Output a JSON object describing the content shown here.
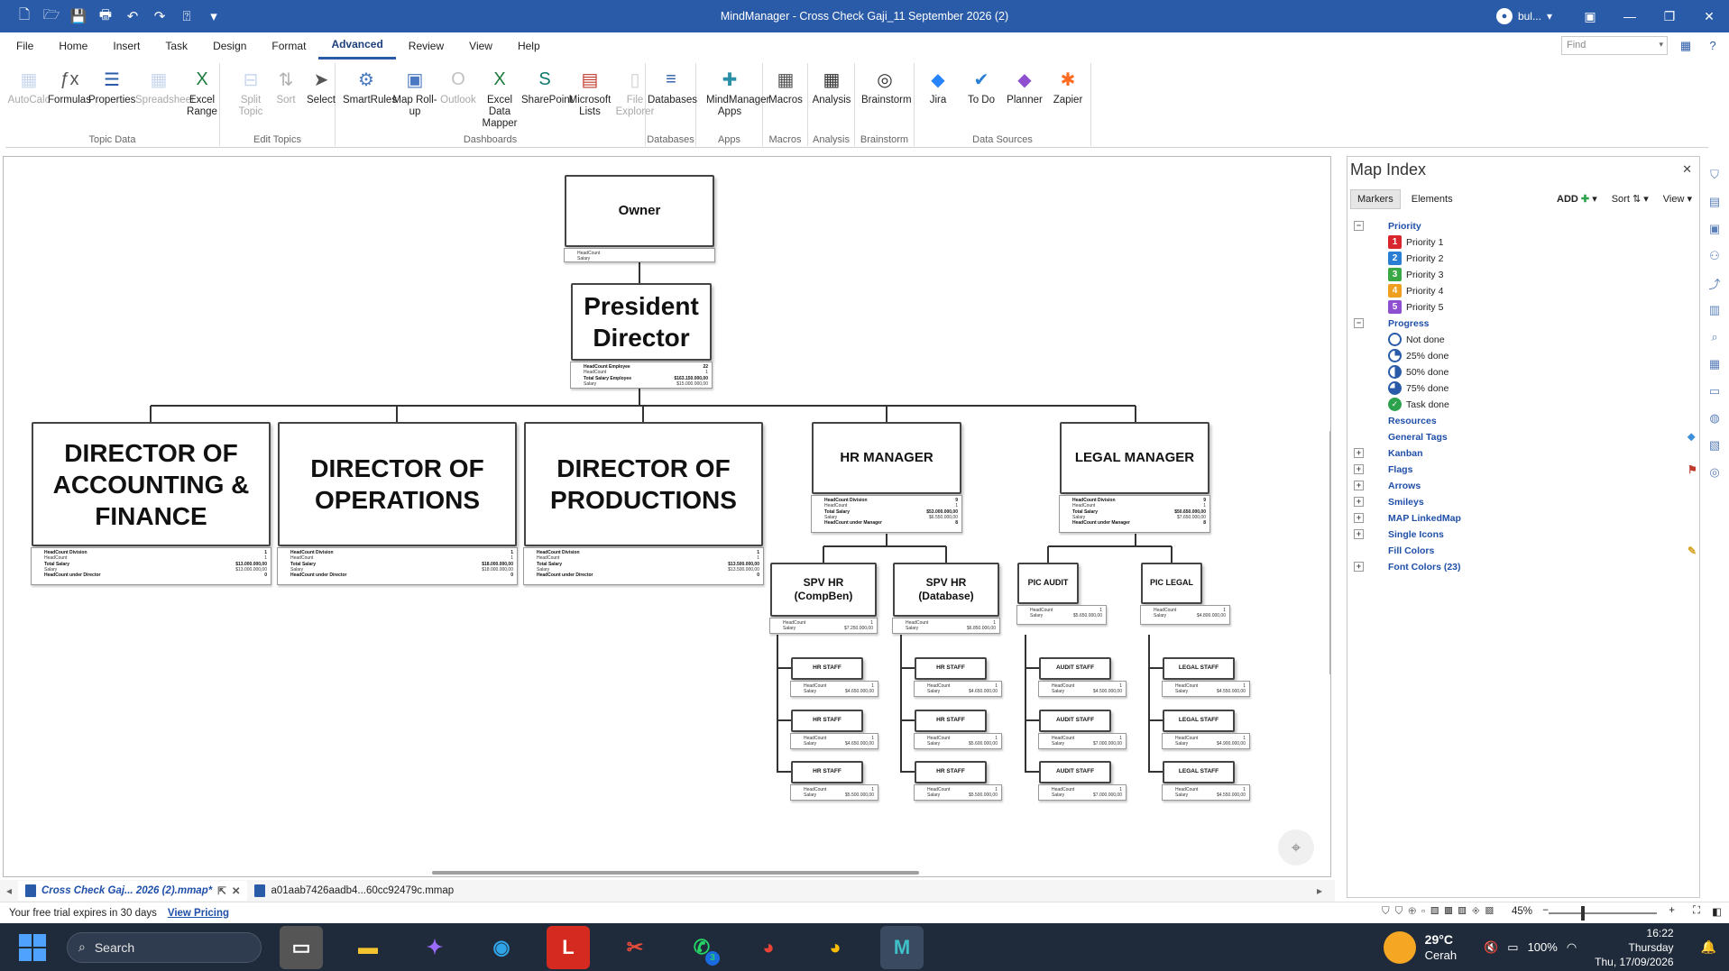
{
  "window": {
    "title": "MindManager - Cross Check Gaji_11 September 2026 (2)",
    "user": "bul..."
  },
  "menu": [
    "File",
    "Home",
    "Insert",
    "Task",
    "Design",
    "Format",
    "Advanced",
    "Review",
    "View",
    "Help"
  ],
  "active_menu": "Advanced",
  "find_placeholder": "Find",
  "ribbon": {
    "groups": [
      {
        "label": "Topic Data",
        "buttons": [
          "AutoCalc",
          "Formulas",
          "Properties",
          "Spreadsheet",
          "Excel Range"
        ]
      },
      {
        "label": "Edit Topics",
        "buttons": [
          "Split Topic",
          "Sort",
          "Select"
        ]
      },
      {
        "label": "Dashboards",
        "buttons": [
          "SmartRules",
          "Map Roll-up",
          "Outlook",
          "Excel Data Mapper",
          "SharePoint",
          "Microsoft Lists",
          "File Explorer"
        ]
      },
      {
        "label": "Databases",
        "buttons": [
          "Databases"
        ]
      },
      {
        "label": "Apps",
        "buttons": [
          "MindManager Apps"
        ]
      },
      {
        "label": "Macros",
        "buttons": [
          "Macros"
        ]
      },
      {
        "label": "Analysis",
        "buttons": [
          "Analysis"
        ]
      },
      {
        "label": "Brainstorm",
        "buttons": [
          "Brainstorm"
        ]
      },
      {
        "label": "Data Sources",
        "buttons": [
          "Jira",
          "To Do",
          "Planner",
          "Zapier"
        ]
      }
    ]
  },
  "map": {
    "owner": {
      "title": "Owner",
      "rows": [
        [
          "HeadCount",
          ""
        ],
        [
          "Salary",
          ""
        ]
      ]
    },
    "president": {
      "title": "President Director",
      "rows": [
        [
          "HeadCount Employee",
          "22"
        ],
        [
          "HeadCount",
          "1"
        ],
        [
          "Total Salary Employee",
          "$163.150.000,00"
        ],
        [
          "Salary",
          "$15.000.000,00"
        ]
      ]
    },
    "directors": [
      {
        "title": "DIRECTOR OF ACCOUNTING & FINANCE",
        "rows": [
          [
            "HeadCount Division",
            "1"
          ],
          [
            "HeadCount",
            "1"
          ],
          [
            "Total Salary",
            "$13.000.000,00"
          ],
          [
            "Salary",
            "$13.000.000,00"
          ],
          [
            "HeadCount under Director",
            "0"
          ]
        ]
      },
      {
        "title": "DIRECTOR OF OPERATIONS",
        "rows": [
          [
            "HeadCount Division",
            "1"
          ],
          [
            "HeadCount",
            "1"
          ],
          [
            "Total Salary",
            "$18.000.000,00"
          ],
          [
            "Salary",
            "$18.000.000,00"
          ],
          [
            "HeadCount under Director",
            "0"
          ]
        ]
      },
      {
        "title": "DIRECTOR OF PRODUCTIONS",
        "rows": [
          [
            "HeadCount Division",
            "1"
          ],
          [
            "HeadCount",
            "1"
          ],
          [
            "Total Salary",
            "$13.500.000,00"
          ],
          [
            "Salary",
            "$13.500.000,00"
          ],
          [
            "HeadCount under Director",
            "0"
          ]
        ]
      }
    ],
    "hr_manager": {
      "title": "HR MANAGER",
      "rows": [
        [
          "HeadCount Division",
          "9"
        ],
        [
          "HeadCount",
          "1"
        ],
        [
          "Total Salary",
          "$53.000.000,00"
        ],
        [
          "Salary",
          "$6.550.000,00"
        ],
        [
          "HeadCount under Manager",
          "8"
        ]
      ]
    },
    "legal_manager": {
      "title": "LEGAL MANAGER",
      "rows": [
        [
          "HeadCount Division",
          "9"
        ],
        [
          "HeadCount",
          "1"
        ],
        [
          "Total Salary",
          "$50.650.000,00"
        ],
        [
          "Salary",
          "$7.650.000,00"
        ],
        [
          "HeadCount under Manager",
          "8"
        ]
      ]
    },
    "spv_compben": {
      "title": "SPV HR\n(CompBen)",
      "rows": [
        [
          "HeadCount",
          "1"
        ],
        [
          "Salary",
          "$7.250.000,00"
        ]
      ]
    },
    "spv_database": {
      "title": "SPV HR\n(Database)",
      "rows": [
        [
          "HeadCount",
          "1"
        ],
        [
          "Salary",
          "$6.850.000,00"
        ]
      ]
    },
    "pic_audit": {
      "title": "PIC AUDIT",
      "rows": [
        [
          "HeadCount",
          "1"
        ],
        [
          "Salary",
          "$5.650.000,00"
        ]
      ]
    },
    "pic_legal": {
      "title": "PIC LEGAL",
      "rows": [
        [
          "HeadCount",
          "1"
        ],
        [
          "Salary",
          "$4.800.000,00"
        ]
      ]
    },
    "hr_staff_a": [
      {
        "title": "HR STAFF",
        "rows": [
          [
            "HeadCount",
            "1"
          ],
          [
            "Salary",
            "$4.650.000,00"
          ]
        ]
      },
      {
        "title": "HR STAFF",
        "rows": [
          [
            "HeadCount",
            "1"
          ],
          [
            "Salary",
            "$4.650.000,00"
          ]
        ]
      },
      {
        "title": "HR STAFF",
        "rows": [
          [
            "HeadCount",
            "1"
          ],
          [
            "Salary",
            "$5.500.000,00"
          ]
        ]
      }
    ],
    "hr_staff_b": [
      {
        "title": "HR STAFF",
        "rows": [
          [
            "HeadCount",
            "1"
          ],
          [
            "Salary",
            "$4.650.000,00"
          ]
        ]
      },
      {
        "title": "HR STAFF",
        "rows": [
          [
            "HeadCount",
            "1"
          ],
          [
            "Salary",
            "$5.600.000,00"
          ]
        ]
      },
      {
        "title": "HR STAFF",
        "rows": [
          [
            "HeadCount",
            "1"
          ],
          [
            "Salary",
            "$5.500.000,00"
          ]
        ]
      }
    ],
    "audit_staff": [
      {
        "title": "AUDIT STAFF",
        "rows": [
          [
            "HeadCount",
            "1"
          ],
          [
            "Salary",
            "$4.500.000,00"
          ]
        ]
      },
      {
        "title": "AUDIT STAFF",
        "rows": [
          [
            "HeadCount",
            "1"
          ],
          [
            "Salary",
            "$7.000.000,00"
          ]
        ]
      },
      {
        "title": "AUDIT STAFF",
        "rows": [
          [
            "HeadCount",
            "1"
          ],
          [
            "Salary",
            "$7.000.000,00"
          ]
        ]
      }
    ],
    "legal_staff": [
      {
        "title": "LEGAL STAFF",
        "rows": [
          [
            "HeadCount",
            "1"
          ],
          [
            "Salary",
            "$4.550.000,00"
          ]
        ]
      },
      {
        "title": "LEGAL STAFF",
        "rows": [
          [
            "HeadCount",
            "1"
          ],
          [
            "Salary",
            "$4.900.000,00"
          ]
        ]
      },
      {
        "title": "LEGAL STAFF",
        "rows": [
          [
            "HeadCount",
            "1"
          ],
          [
            "Salary",
            "$4.550.000,00"
          ]
        ]
      }
    ]
  },
  "map_index": {
    "title": "Map Index",
    "tabs": [
      "Markers",
      "Elements"
    ],
    "add_label": "ADD",
    "sort_label": "Sort",
    "view_label": "View",
    "priority_label": "Priority",
    "priorities": [
      "Priority 1",
      "Priority 2",
      "Priority 3",
      "Priority 4",
      "Priority 5"
    ],
    "priority_colors": [
      "#d9262e",
      "#2a7fd4",
      "#3aa845",
      "#f0a020",
      "#8e4fd0"
    ],
    "progress_label": "Progress",
    "progress": [
      "Not done",
      "25% done",
      "50% done",
      "75% done",
      "Task done"
    ],
    "categories": [
      "Resources",
      "General Tags",
      "Kanban",
      "Flags",
      "Arrows",
      "Smileys",
      "MAP LinkedMap",
      "Single Icons",
      "Fill Colors",
      "Font Colors (23)"
    ]
  },
  "doc_tabs": [
    "Cross Check Gaj... 2026 (2).mmap*",
    "a01aab7426aadb4...60cc92479c.mmap"
  ],
  "status": {
    "trial": "Your free trial expires in 30 days",
    "view_pricing": "View Pricing",
    "zoom": "45%"
  },
  "taskbar": {
    "search": "Search",
    "whatsapp_badge": "3",
    "temperature": "29°C",
    "weather": "Cerah",
    "battery": "100%",
    "time": "16:22",
    "day": "Thursday",
    "date": "Thu, 17/09/2026"
  }
}
